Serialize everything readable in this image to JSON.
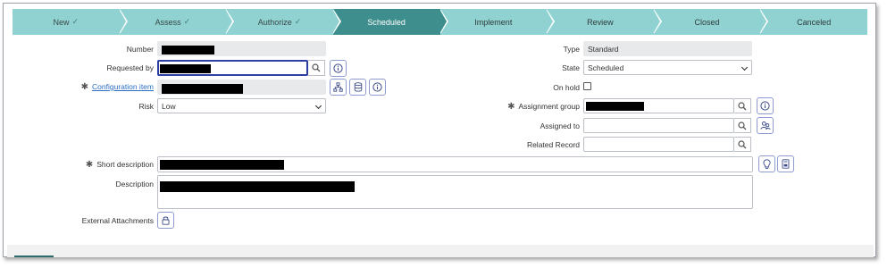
{
  "flow": {
    "steps": [
      {
        "label": "New",
        "state": "done"
      },
      {
        "label": "Assess",
        "state": "done"
      },
      {
        "label": "Authorize",
        "state": "done"
      },
      {
        "label": "Scheduled",
        "state": "active"
      },
      {
        "label": "Implement",
        "state": "pending"
      },
      {
        "label": "Review",
        "state": "pending"
      },
      {
        "label": "Closed",
        "state": "pending"
      },
      {
        "label": "Canceled",
        "state": "pending"
      }
    ],
    "check_glyph": "✓"
  },
  "form": {
    "number_label": "Number",
    "requested_by_label": "Requested by",
    "configuration_item_label": "Configuration item",
    "risk_label": "Risk",
    "risk_value": "Low",
    "short_description_label": "Short description",
    "description_label": "Description",
    "external_attachments_label": "External Attachments",
    "type_label": "Type",
    "type_value": "Standard",
    "state_label": "State",
    "state_value": "Scheduled",
    "on_hold_label": "On hold",
    "assignment_group_label": "Assignment group",
    "assigned_to_label": "Assigned to",
    "related_record_label": "Related Record",
    "required_marker": "✱"
  },
  "icons": {
    "search": "search-icon",
    "info": "info-icon",
    "tree": "tree-icon",
    "database": "database-icon",
    "lock": "lock-icon",
    "lightbulb": "lightbulb-icon",
    "book": "book-icon",
    "users": "users-icon"
  },
  "colors": {
    "flow_step": "#8fd2d1",
    "flow_active": "#3e8e8d",
    "focus_border": "#2d3fa3",
    "link": "#2b6ec4"
  }
}
